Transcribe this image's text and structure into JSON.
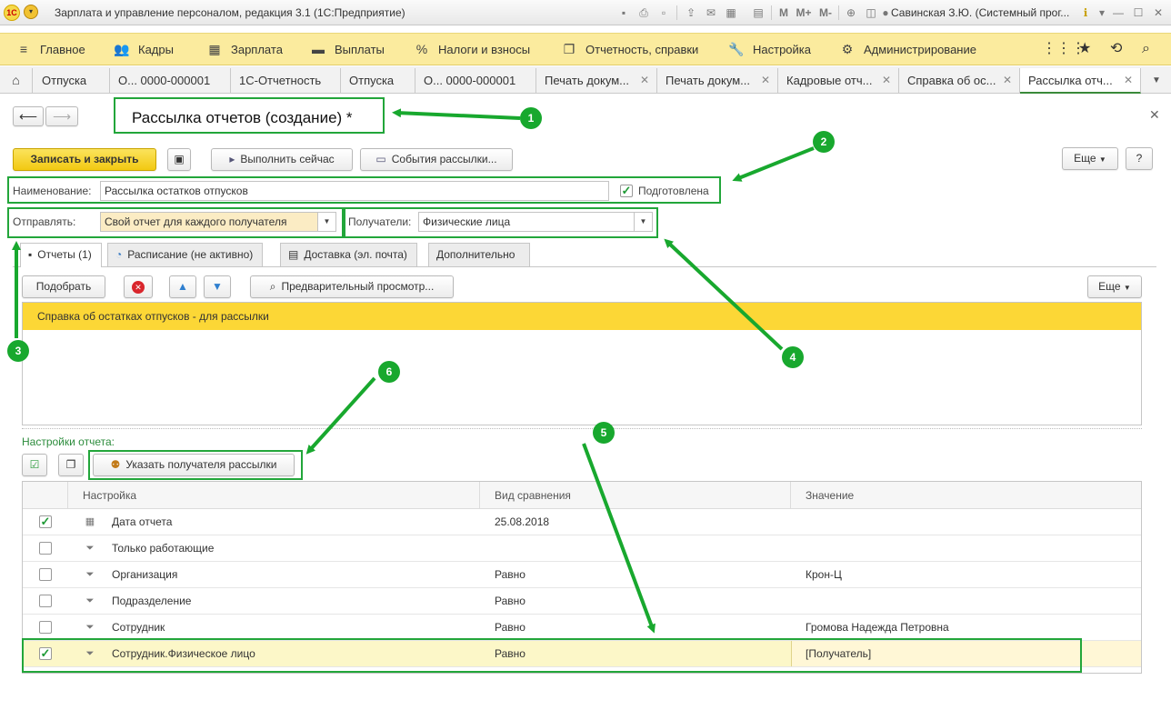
{
  "window": {
    "title": "Зарплата и управление персоналом, редакция 3.1  (1С:Предприятие)",
    "user": "Савинская З.Ю. (Системный прог..."
  },
  "sections": [
    {
      "label": "Главное",
      "icon": "menu-icon"
    },
    {
      "label": "Кадры",
      "icon": "people-icon"
    },
    {
      "label": "Зарплата",
      "icon": "calculator-icon"
    },
    {
      "label": "Выплаты",
      "icon": "wallet-icon"
    },
    {
      "label": "Налоги и взносы",
      "icon": "percent-icon"
    },
    {
      "label": "Отчетность, справки",
      "icon": "documents-icon"
    },
    {
      "label": "Настройка",
      "icon": "wrench-icon"
    },
    {
      "label": "Администрирование",
      "icon": "gear-icon"
    }
  ],
  "open_tabs": [
    "Отпуска",
    "О... 0000-000001",
    "1С-Отчетность",
    "Отпуска",
    "О... 0000-000001",
    "Печать докум...",
    "Печать докум...",
    "Кадровые отч...",
    "Справка об ос...",
    "Рассылка отч..."
  ],
  "form": {
    "title": "Рассылка отчетов (создание) *",
    "buttons": {
      "save_close": "Записать и закрыть",
      "run_now": "Выполнить сейчас",
      "events": "События рассылки...",
      "more": "Еще",
      "help": "?"
    },
    "name_label": "Наименование:",
    "name_value": "Рассылка остатков отпусков",
    "prepared_label": "Подготовлена",
    "prepared_checked": true,
    "send_label": "Отправлять:",
    "send_value": "Свой отчет для каждого получателя",
    "recipients_label": "Получатели:",
    "recipients_value": "Физические лица"
  },
  "form_tabs": [
    "Отчеты (1)",
    "Расписание (не активно)",
    "Доставка (эл. почта)",
    "Дополнительно"
  ],
  "reports_toolbar": {
    "pick": "Подобрать",
    "preview": "Предварительный просмотр...",
    "more": "Еще"
  },
  "reports": [
    "Справка об остатках отпусков - для рассылки"
  ],
  "settings": {
    "label": "Настройки отчета:",
    "set_recipient": "Указать получателя рассылки",
    "columns": [
      "Настройка",
      "Вид сравнения",
      "Значение"
    ],
    "rows": [
      {
        "checked": true,
        "name": "Дата отчета",
        "comparison": "25.08.2018",
        "value": ""
      },
      {
        "checked": false,
        "name": "Только работающие",
        "comparison": "",
        "value": ""
      },
      {
        "checked": false,
        "name": "Организация",
        "comparison": "Равно",
        "value": "Крон-Ц"
      },
      {
        "checked": false,
        "name": "Подразделение",
        "comparison": "Равно",
        "value": ""
      },
      {
        "checked": false,
        "name": "Сотрудник",
        "comparison": "Равно",
        "value": "Громова Надежда Петровна"
      },
      {
        "checked": true,
        "name": "Сотрудник.Физическое лицо",
        "comparison": "Равно",
        "value": "[Получатель]"
      }
    ]
  },
  "callouts": [
    "1",
    "2",
    "3",
    "4",
    "5",
    "6"
  ],
  "colors": {
    "accent_green": "#22a63a",
    "section_bg": "#fbeb9e",
    "primary_button": "#f2c912",
    "selected_row": "#fcd736"
  }
}
